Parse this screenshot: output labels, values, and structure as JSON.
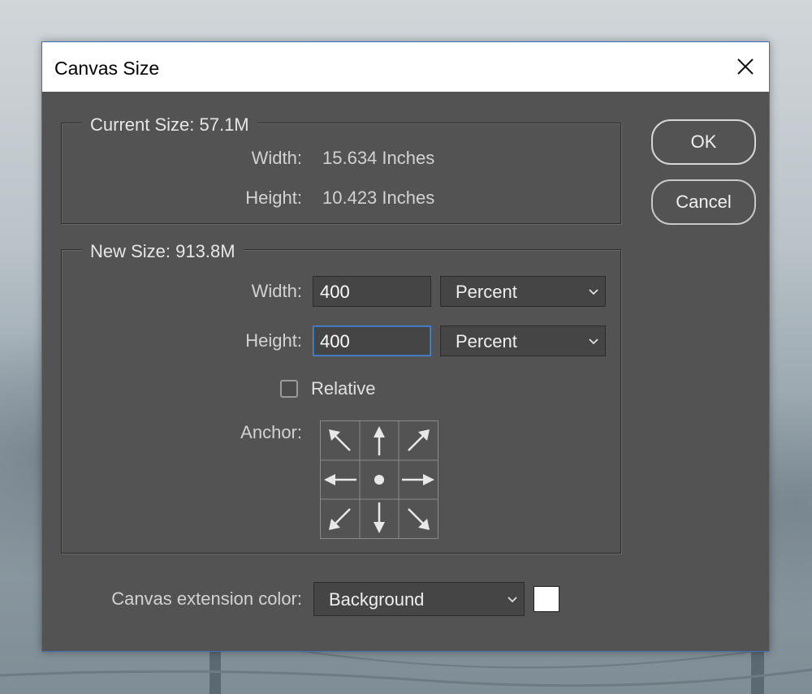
{
  "dialog": {
    "title": "Canvas Size",
    "close_icon": "close-icon"
  },
  "current_size": {
    "legend": "Current Size: 57.1M",
    "width_label": "Width:",
    "width_value": "15.634 Inches",
    "height_label": "Height:",
    "height_value": "10.423 Inches"
  },
  "new_size": {
    "legend": "New Size: 913.8M",
    "width_label": "Width:",
    "width_value": "400",
    "width_unit": "Percent",
    "height_label": "Height:",
    "height_value": "400",
    "height_unit": "Percent",
    "relative_label": "Relative",
    "relative_checked": false,
    "anchor_label": "Anchor:",
    "anchor_selected": "center"
  },
  "buttons": {
    "ok": "OK",
    "cancel": "Cancel"
  },
  "extension": {
    "label": "Canvas extension color:",
    "value": "Background",
    "swatch_color": "#ffffff"
  },
  "colors": {
    "dialog_bg": "#535353",
    "title_bg": "#ffffff",
    "focus_border": "#4a86d4"
  }
}
